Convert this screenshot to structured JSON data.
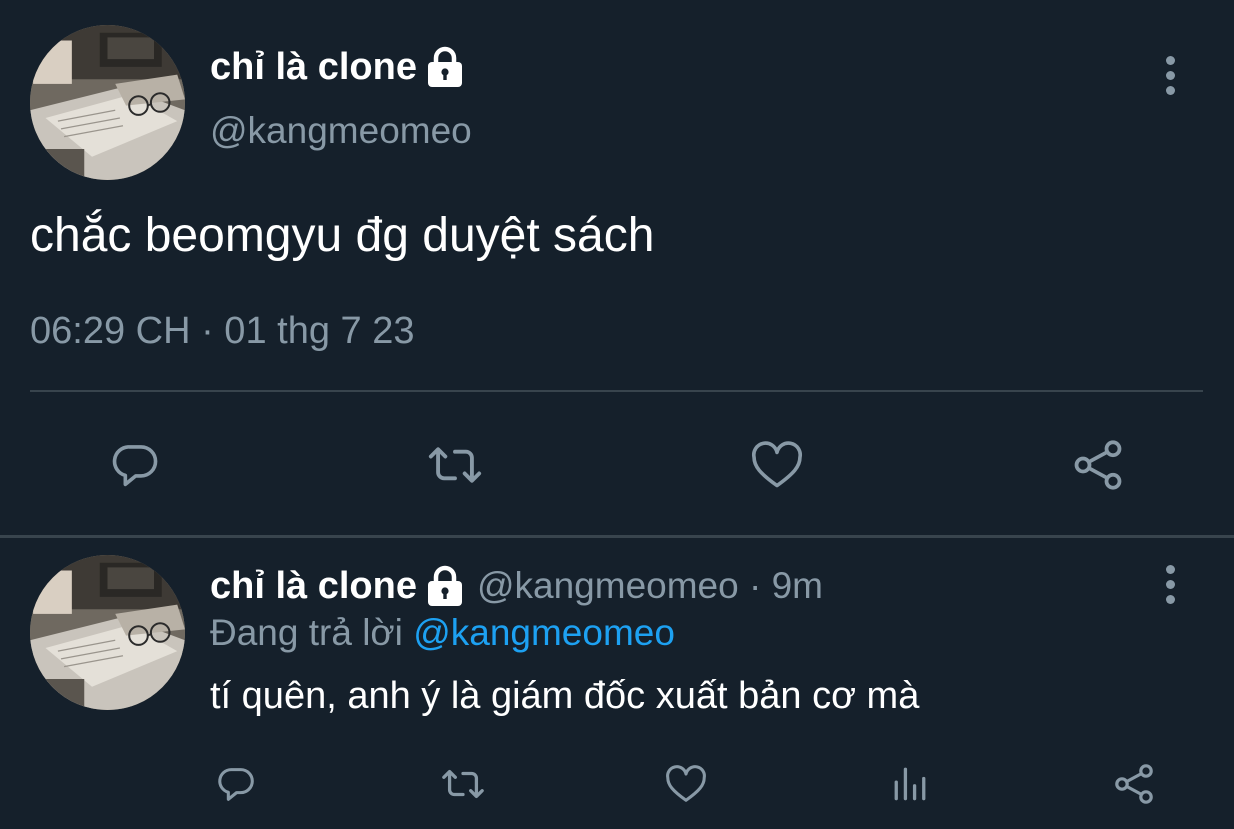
{
  "main_tweet": {
    "display_name": "chỉ là clone",
    "handle": "@kangmeomeo",
    "text": "chắc beomgyu đg duyệt sách",
    "timestamp": "06:29 CH · 01 thg 7 23",
    "avatar_icon": "profile-photo-books-glasses",
    "lock_icon": "lock-icon",
    "actions": [
      "reply-icon",
      "retweet-icon",
      "like-icon",
      "share-icon"
    ]
  },
  "reply_tweet": {
    "display_name": "chỉ là clone",
    "handle_time": "@kangmeomeo · 9m",
    "replying_label": "Đang trả lời ",
    "replying_mention": "@kangmeomeo",
    "text": "tí quên, anh ý là giám đốc xuất bản cơ mà",
    "avatar_icon": "profile-photo-books-glasses",
    "actions": [
      "reply-icon",
      "retweet-icon",
      "like-icon",
      "stats-icon",
      "share-icon"
    ]
  },
  "colors": {
    "background": "#15202b",
    "text_primary": "#ffffff",
    "text_secondary": "#8899a6",
    "divider": "#38444d",
    "accent": "#1da1f2"
  }
}
